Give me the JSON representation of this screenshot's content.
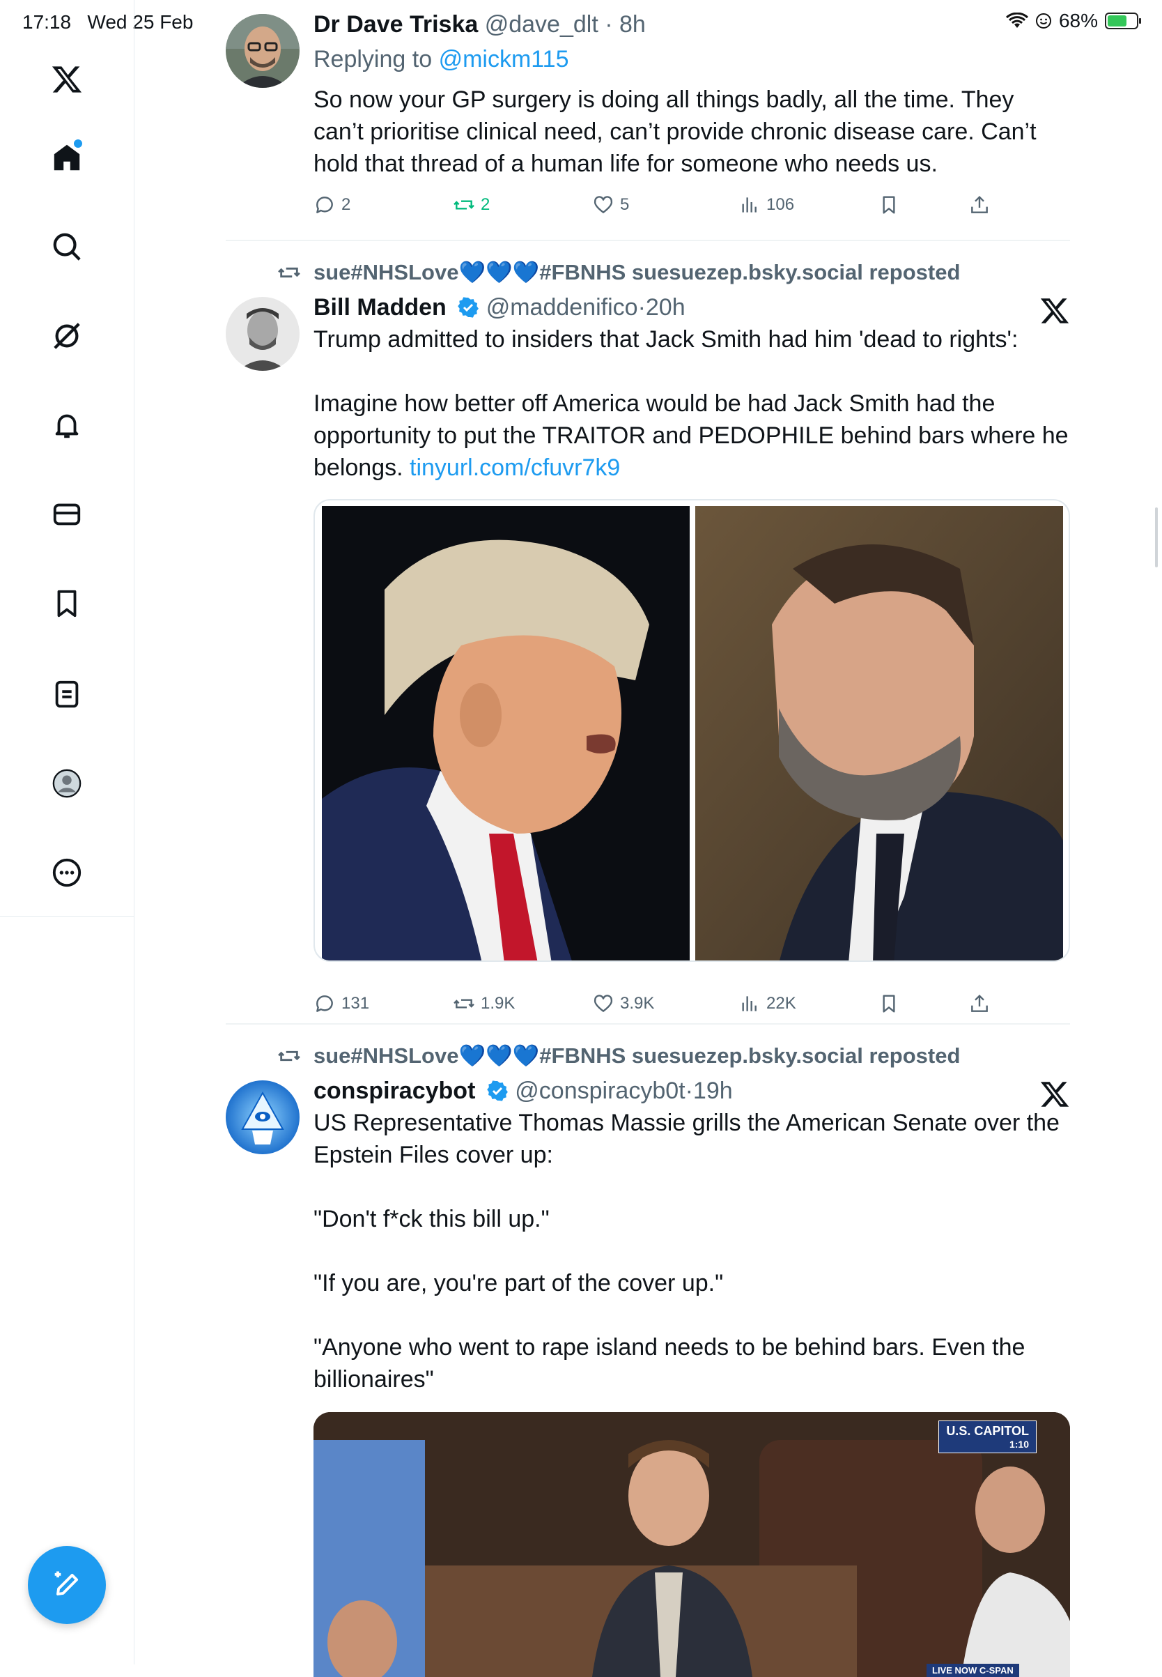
{
  "status_bar": {
    "time": "17:18",
    "date": "Wed 25 Feb",
    "battery": "68%",
    "battery_level": 0.68
  },
  "sidebar": {
    "items": [
      {
        "icon": "x-logo-icon"
      },
      {
        "icon": "home-icon",
        "has_notification": true
      },
      {
        "icon": "search-icon"
      },
      {
        "icon": "grok-icon"
      },
      {
        "icon": "bell-icon"
      },
      {
        "icon": "mail-icon"
      },
      {
        "icon": "bookmark-icon"
      },
      {
        "icon": "lists-icon"
      },
      {
        "icon": "profile-icon"
      },
      {
        "icon": "more-icon"
      }
    ],
    "compose_icon": "compose-icon"
  },
  "tweets": [
    {
      "name": "Dr Dave Triska",
      "handle": "@dave_dlt",
      "time": "8h",
      "replying_label": "Replying to",
      "replying_to": "@mickm115",
      "text": "So now your GP surgery is doing all things badly, all the time. They can’t prioritise clinical need, can’t provide chronic disease care. Can’t hold that thread of a human life for someone who needs us.",
      "stats": {
        "replies": "2",
        "reposts": "2",
        "likes": "5",
        "views": "106"
      }
    },
    {
      "repost_by_prefix": "sue#NHSLove",
      "repost_by_hearts": "💙💙💙",
      "repost_by_suffix": "#FBNHS suesuezep.bsky.social reposted",
      "name": "Bill Madden",
      "handle": "@maddenifico",
      "time": "20h",
      "text_line1": "Trump admitted to insiders that Jack Smith had him 'dead to rights':",
      "text_line2": "Imagine how better off America would be had Jack Smith had the opportunity to put the TRAITOR and PEDOPHILE behind bars where he belongs.",
      "link": "tinyurl.com/cfuvr7k9",
      "stats": {
        "replies": "131",
        "reposts": "1.9K",
        "likes": "3.9K",
        "views": "22K"
      }
    },
    {
      "repost_by_prefix": "sue#NHSLove",
      "repost_by_hearts": "💙💙💙",
      "repost_by_suffix": "#FBNHS suesuezep.bsky.social reposted",
      "name": "conspiracybot",
      "handle": "@conspiracyb0t",
      "time": "19h",
      "para1": "US Representative Thomas Massie grills the American Senate over the Epstein Files cover up:",
      "para2": "\"Don't f*ck this bill up.\"",
      "para3": "\"If you are, you're part of the cover up.\"",
      "para4": "\"Anyone who went to rape island needs to be behind bars. Even the billionaires\"",
      "video_label": "U.S. CAPITOL",
      "video_time": "1:10",
      "video_footer": "LIVE NOW C-SPAN"
    }
  ],
  "colors": {
    "accent": "#1d9bf0",
    "repost_green": "#00ba7c",
    "muted": "#536471"
  }
}
